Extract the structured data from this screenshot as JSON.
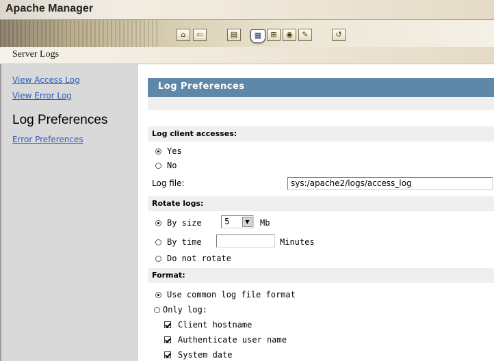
{
  "app": {
    "title": "Apache Manager",
    "section": "Server Logs"
  },
  "toolbar": {
    "buttons": [
      {
        "name": "home-icon",
        "glyph": "⌂"
      },
      {
        "name": "logout-icon",
        "glyph": "⇦"
      },
      {
        "name": "edit-config-icon",
        "glyph": "▤"
      },
      {
        "name": "server-logs-icon",
        "glyph": "▦"
      },
      {
        "name": "directory-tree-icon",
        "glyph": "⊞"
      },
      {
        "name": "audio-icon",
        "glyph": "◉"
      },
      {
        "name": "admin-tools-icon",
        "glyph": "✎"
      },
      {
        "name": "refresh-icon",
        "glyph": "↺"
      }
    ]
  },
  "sidebar": {
    "links": [
      "View Access Log",
      "View Error Log"
    ],
    "current": "Log Preferences",
    "error_prefs": "Error Preferences"
  },
  "main": {
    "panel_title": "Log Preferences",
    "log_client": {
      "heading": "Log client accesses:",
      "yes": "Yes",
      "no": "No",
      "selected": "Yes"
    },
    "log_file": {
      "label": "Log file:",
      "value": "sys:/apache2/logs/access_log"
    },
    "rotate": {
      "heading": "Rotate logs:",
      "by_size": "By size",
      "size_value": "5",
      "size_unit": "Mb",
      "by_time": "By time",
      "time_value": "",
      "time_unit": "Minutes",
      "no_rotate": "Do not rotate",
      "selected": "By size"
    },
    "format": {
      "heading": "Format:",
      "common": "Use common log file format",
      "only_log": "Only log:",
      "selected": "Use common log file format",
      "checks": [
        {
          "label": "Client hostname",
          "checked": true
        },
        {
          "label": "Authenticate user name",
          "checked": true
        },
        {
          "label": "System date",
          "checked": true
        }
      ]
    }
  },
  "colors": {
    "banner": "#5f87a8",
    "sidebar": "#d9d9d9",
    "link": "#2a5bb8",
    "group_head": "#efefef"
  }
}
